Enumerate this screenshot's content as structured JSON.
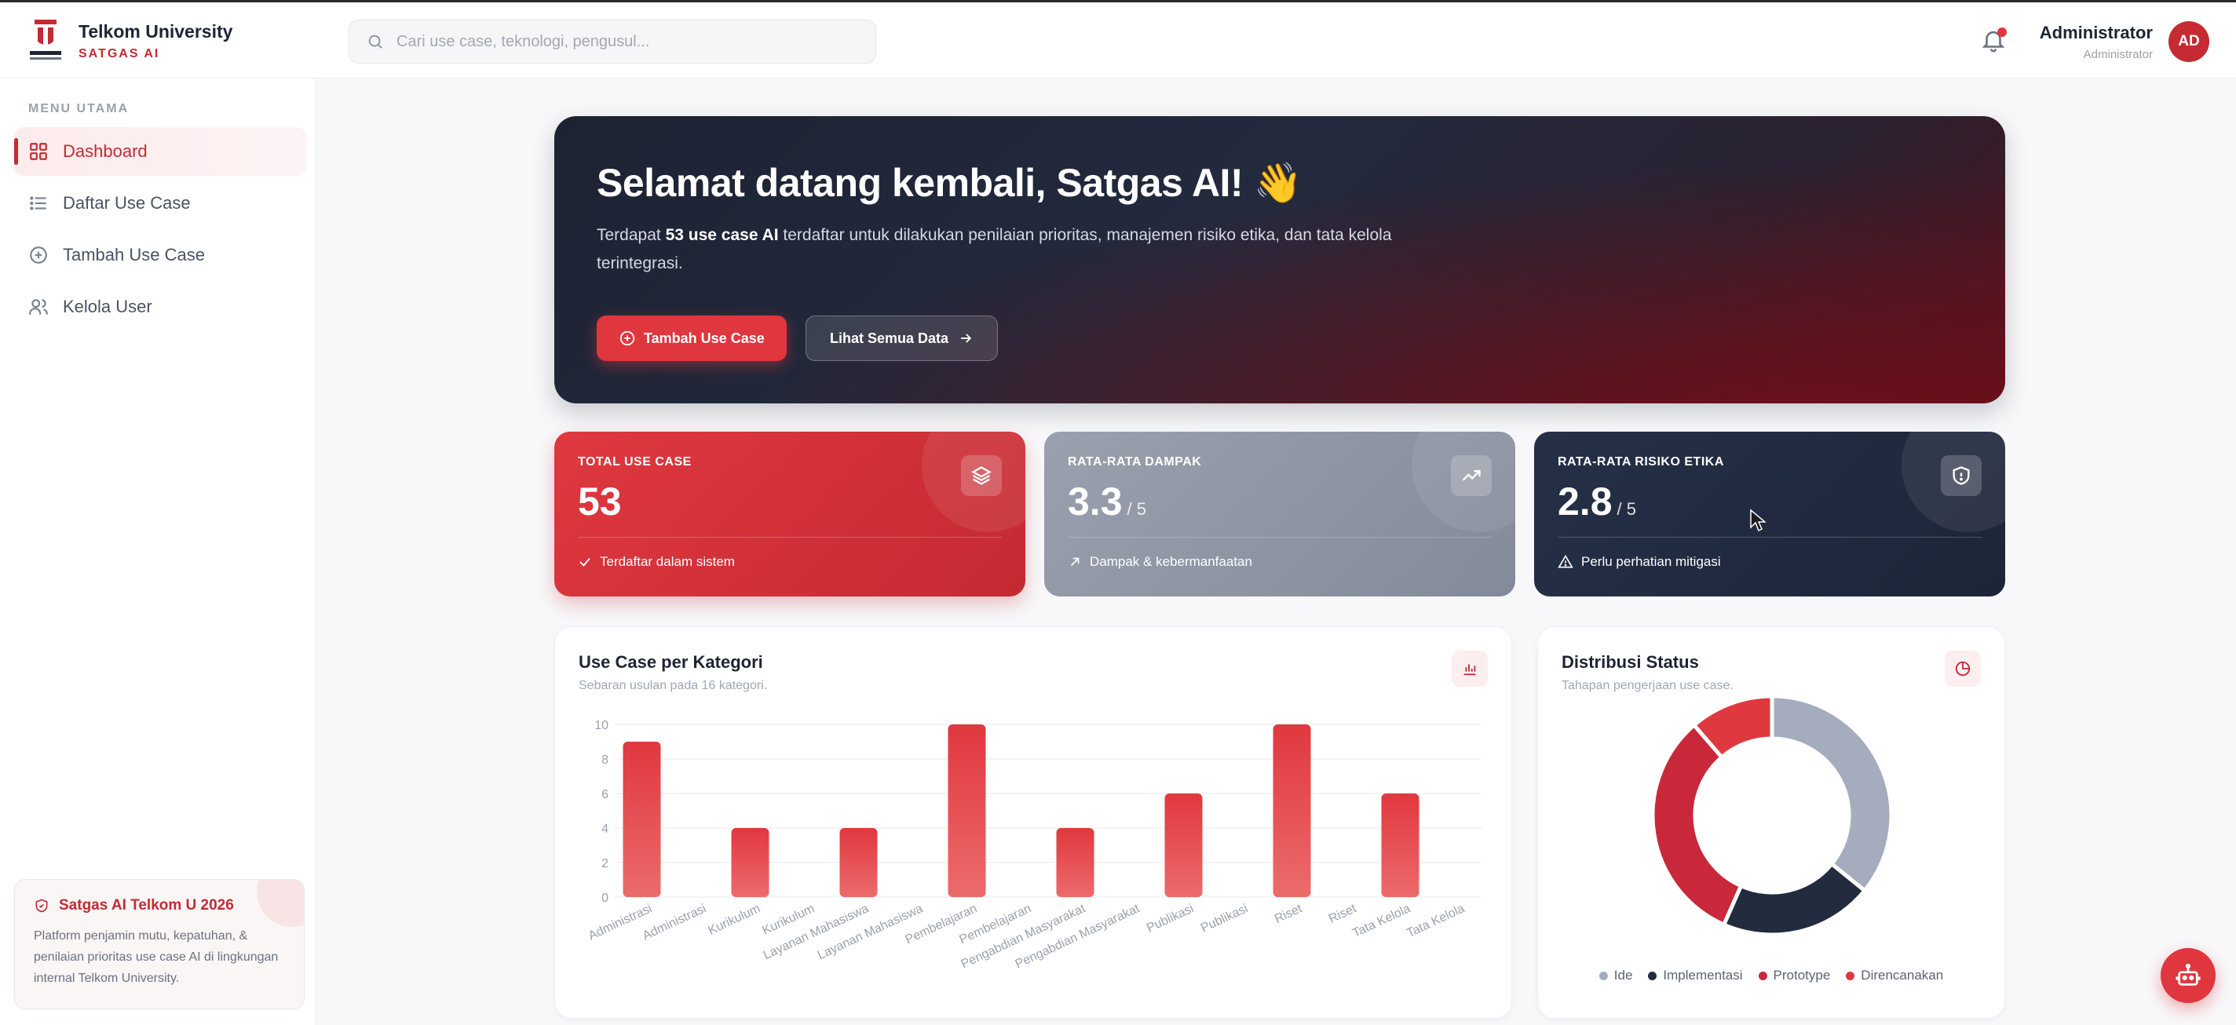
{
  "brand": {
    "name": "Telkom University",
    "sub": "SATGAS AI"
  },
  "search": {
    "placeholder": "Cari use case, teknologi, pengusul..."
  },
  "user": {
    "name": "Administrator",
    "role": "Administrator",
    "initials": "AD"
  },
  "sidebar": {
    "heading": "MENU UTAMA",
    "items": [
      {
        "label": "Dashboard",
        "icon": "grid-icon",
        "active": true
      },
      {
        "label": "Daftar Use Case",
        "icon": "list-icon"
      },
      {
        "label": "Tambah Use Case",
        "icon": "plus-circle-icon"
      },
      {
        "label": "Kelola User",
        "icon": "users-icon"
      }
    ],
    "promo": {
      "title": "Satgas AI Telkom U 2026",
      "body": "Platform penjamin mutu, kepatuhan, & penilaian prioritas use case AI di lingkungan internal Telkom University."
    }
  },
  "hero": {
    "title": "Selamat datang kembali, Satgas AI! 👋",
    "desc_pre": "Terdapat ",
    "desc_bold": "53 use case AI",
    "desc_post": " terdaftar untuk dilakukan penilaian prioritas, manajemen risiko etika, dan tata kelola terintegrasi.",
    "primary_button": "Tambah Use Case",
    "secondary_button": "Lihat Semua Data"
  },
  "stats": [
    {
      "label": "TOTAL USE CASE",
      "value": "53",
      "suffix": "",
      "footer": "Terdaftar dalam sistem",
      "icon": "layers-icon"
    },
    {
      "label": "RATA-RATA DAMPAK",
      "value": "3.3",
      "suffix": "/ 5",
      "footer": "Dampak & kebermanfaatan",
      "icon": "trending-up-icon"
    },
    {
      "label": "RATA-RATA RISIKO ETIKA",
      "value": "2.8",
      "suffix": "/ 5",
      "footer": "Perlu perhatian mitigasi",
      "icon": "shield-icon"
    }
  ],
  "colors": {
    "accent": "#c42a32",
    "red": "#e0363d",
    "navy": "#1e2433",
    "gray": "#a0a6b4"
  },
  "bar_panel": {
    "title": "Use Case per Kategori",
    "subtitle": "Sebaran usulan pada 16 kategori."
  },
  "donut_panel": {
    "title": "Distribusi Status",
    "subtitle": "Tahapan pengerjaan use case."
  },
  "chart_data": [
    {
      "type": "bar",
      "title": "Use Case per Kategori",
      "categories": [
        "Administrasi",
        "Administrasi",
        "Kurikulum",
        "Kurikulum",
        "Layanan Mahasiswa",
        "Layanan Mahasiswa",
        "Pembelajaran",
        "Pembelajaran",
        "Pengabdian Masyarakat",
        "Pengabdian Masyarakat",
        "Publikasi",
        "Publikasi",
        "Riset",
        "Riset",
        "Tata Kelola",
        "Tata Kelola"
      ],
      "values": [
        9,
        0,
        4,
        0,
        4,
        0,
        10,
        0,
        4,
        0,
        6,
        0,
        10,
        0,
        6,
        0
      ],
      "ylim": [
        0,
        10
      ],
      "yticks": [
        0,
        2,
        4,
        6,
        8,
        10
      ],
      "grid": true
    },
    {
      "type": "pie",
      "title": "Distribusi Status",
      "labels": [
        "Ide",
        "Implementasi",
        "Prototype",
        "Direncanakan"
      ],
      "values": [
        19,
        11,
        17,
        6
      ],
      "colors": [
        "#a4acbd",
        "#232b3e",
        "#c8283a",
        "#e0383f"
      ],
      "legend": "bottom"
    }
  ]
}
